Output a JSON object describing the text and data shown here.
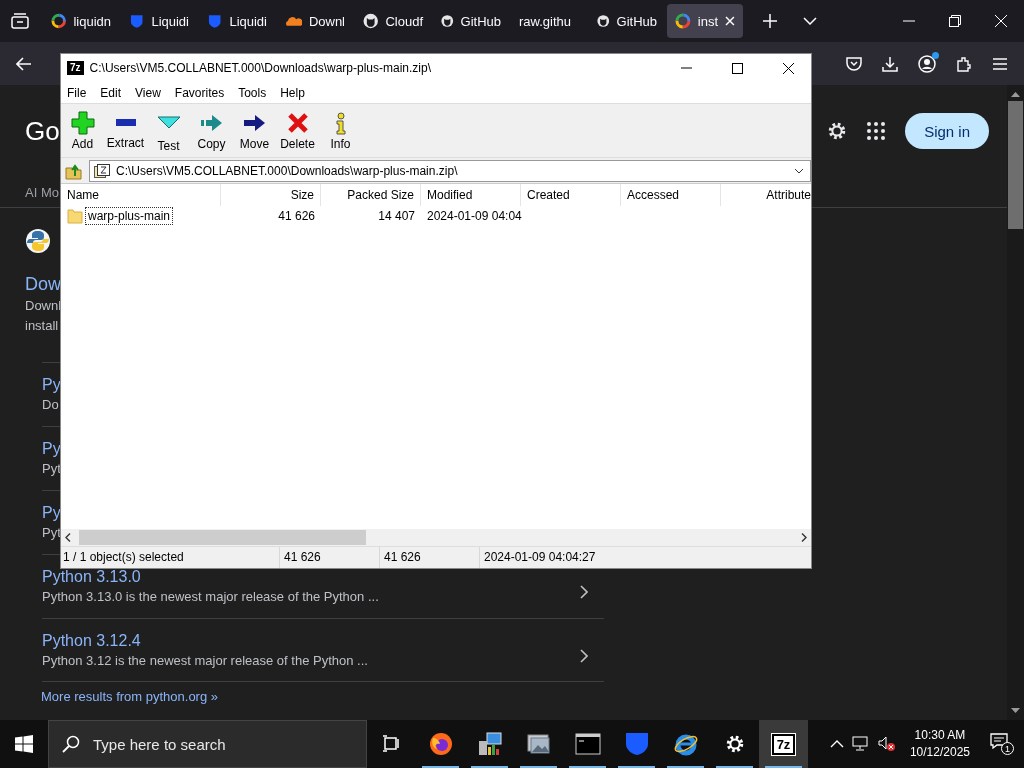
{
  "browser": {
    "tabs": [
      {
        "label": "liquidn",
        "kind": "ring",
        "selected": false
      },
      {
        "label": "Liquidi",
        "kind": "shield",
        "selected": false
      },
      {
        "label": "Liquidi",
        "kind": "shield",
        "selected": false
      },
      {
        "label": "Downl",
        "kind": "cloud",
        "selected": false
      },
      {
        "label": "Cloudf",
        "kind": "cat",
        "selected": false
      },
      {
        "label": "GitHub",
        "kind": "cat",
        "selected": false
      },
      {
        "label": "raw.githu",
        "kind": "none",
        "selected": false
      },
      {
        "label": "GitHub",
        "kind": "cat",
        "selected": false
      },
      {
        "label": "inst",
        "kind": "ring",
        "selected": true
      }
    ],
    "account_notification": true
  },
  "page": {
    "logo_text": "Go",
    "sign_in": "Sign in",
    "tab_label": "AI Mo",
    "main_result": {
      "title": "Dow",
      "snippet_lines": [
        "Downl",
        "install"
      ]
    },
    "sub_results": [
      {
        "title": "Py",
        "snippet": "Do",
        "chevron": false
      },
      {
        "title": "Py",
        "snippet": "Pyt",
        "chevron": false
      },
      {
        "title": "Py",
        "snippet": "Pyt",
        "chevron": false
      },
      {
        "title": "Python 3.13.0",
        "snippet": "Python 3.13.0 is the newest major release of the Python ...",
        "chevron": true
      },
      {
        "title": "Python 3.12.4",
        "snippet": "Python 3.12 is the newest major release of the Python ...",
        "chevron": true
      }
    ],
    "more_link": "More results from python.org »"
  },
  "archiver": {
    "title": "C:\\Users\\VM5.COLLABNET.000\\Downloads\\warp-plus-main.zip\\",
    "icon_text": "7z",
    "menu": [
      "File",
      "Edit",
      "View",
      "Favorites",
      "Tools",
      "Help"
    ],
    "tools": [
      {
        "label": "Add",
        "kind": "add"
      },
      {
        "label": "Extract",
        "kind": "extract"
      },
      {
        "label": "Test",
        "kind": "test"
      },
      {
        "label": "Copy",
        "kind": "copy"
      },
      {
        "label": "Move",
        "kind": "move"
      },
      {
        "label": "Delete",
        "kind": "delete"
      },
      {
        "label": "Info",
        "kind": "info"
      }
    ],
    "path": "C:\\Users\\VM5.COLLABNET.000\\Downloads\\warp-plus-main.zip\\",
    "columns": [
      "Name",
      "Size",
      "Packed Size",
      "Modified",
      "Created",
      "Accessed",
      "Attribute"
    ],
    "rows": [
      {
        "name": "warp-plus-main",
        "size": "41 626",
        "packed_size": "14 407",
        "modified": "2024-01-09 04:04",
        "selected": true
      }
    ],
    "status": [
      "1 / 1 object(s) selected",
      "41 626",
      "41 626",
      "2024-01-09 04:04:27"
    ]
  },
  "taskbar": {
    "search_placeholder": "Type here to search",
    "apps": [
      {
        "kind": "task-view",
        "running": false,
        "selected": false
      },
      {
        "kind": "firefox",
        "running": true,
        "selected": false
      },
      {
        "kind": "control-panel",
        "running": true,
        "selected": false
      },
      {
        "kind": "photos",
        "running": true,
        "selected": false
      },
      {
        "kind": "terminal",
        "running": true,
        "selected": false
      },
      {
        "kind": "shield",
        "running": true,
        "selected": false
      },
      {
        "kind": "ie",
        "running": true,
        "selected": false
      },
      {
        "kind": "settings",
        "running": true,
        "selected": false
      },
      {
        "kind": "archiver",
        "label": "7z",
        "running": true,
        "selected": true
      }
    ],
    "time": "10:30 AM",
    "date": "10/12/2025",
    "notifications": "1"
  }
}
